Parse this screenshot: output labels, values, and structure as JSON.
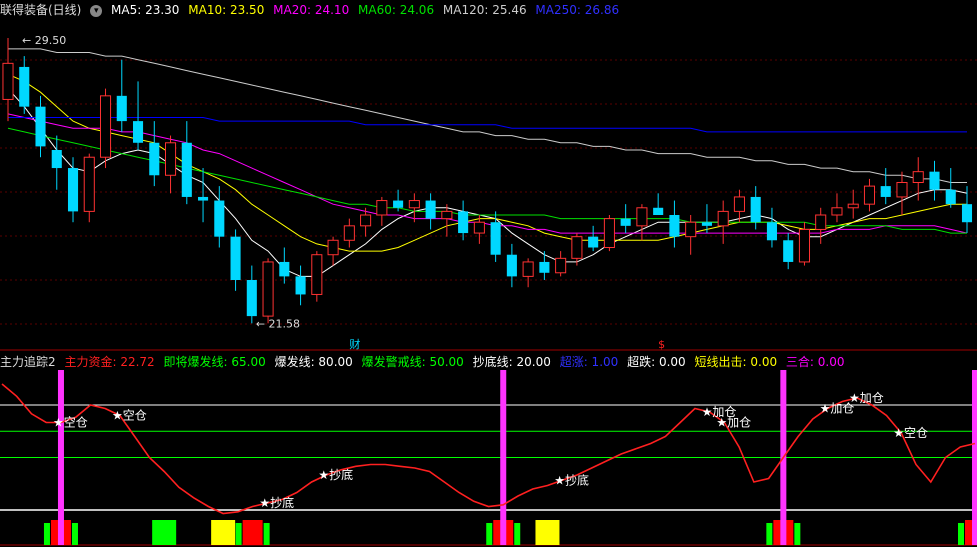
{
  "colors": {
    "up": "#ff3232",
    "down": "#00d8ff",
    "ma5": "#ffffff",
    "ma10": "#ffff00",
    "ma20": "#ff00ff",
    "ma60": "#00e000",
    "ma120": "#cccccc",
    "ma250": "#0000ff",
    "main_fund": "#ff2020",
    "about_to_burst": "#00ff00",
    "burst": "#ffffff",
    "warn": "#00ff00",
    "bottom": "#ffffff",
    "surge": "#0000ff",
    "over": "#ffffff",
    "short_exit": "#ffff00",
    "three": "#ff00ff",
    "bg": "#000000"
  },
  "top_header": {
    "title": "联得装备(日线)",
    "ma5": "MA5: 23.30",
    "ma10": "MA10: 23.50",
    "ma20": "MA20: 24.10",
    "ma60": "MA60: 24.06",
    "ma120": "MA120: 25.46",
    "ma250": "MA250: 26.86"
  },
  "bottom_header": {
    "title": "主力追踪2",
    "main_fund": "主力资金: 22.72",
    "about_to_burst": "即将爆发线: 65.00",
    "burst": "爆发线: 80.00",
    "warn": "爆发警戒线: 50.00",
    "bottom": "抄底线: 20.00",
    "surge": "超涨: 1.00",
    "over": "超跌: 0.00",
    "short_exit": "短线出击: 0.00",
    "three": "三合: 0.00"
  },
  "price_labels": {
    "high": "29.50",
    "low": "21.58"
  },
  "markers": {
    "finance": "财",
    "dividend": "$"
  },
  "chart_data": [
    {
      "type": "candlestick",
      "title": "联得装备(日线)",
      "ylim": [
        21,
        30
      ],
      "ohlc": [
        [
          27.8,
          29.5,
          27.2,
          28.8
        ],
        [
          28.7,
          29.0,
          27.4,
          27.6
        ],
        [
          27.6,
          27.9,
          26.2,
          26.5
        ],
        [
          26.4,
          26.8,
          25.3,
          25.9
        ],
        [
          25.9,
          26.2,
          24.4,
          24.7
        ],
        [
          24.7,
          26.3,
          24.4,
          26.2
        ],
        [
          26.2,
          28.1,
          25.9,
          27.9
        ],
        [
          27.9,
          28.9,
          26.9,
          27.2
        ],
        [
          27.2,
          28.3,
          26.4,
          26.6
        ],
        [
          26.6,
          27.2,
          25.4,
          25.7
        ],
        [
          25.7,
          26.8,
          25.2,
          26.6
        ],
        [
          26.6,
          27.2,
          24.9,
          25.1
        ],
        [
          25.1,
          25.9,
          24.4,
          25.0
        ],
        [
          25.0,
          25.4,
          23.7,
          24.0
        ],
        [
          24.0,
          24.2,
          22.5,
          22.8
        ],
        [
          22.8,
          23.2,
          21.6,
          21.8
        ],
        [
          21.8,
          23.4,
          21.6,
          23.3
        ],
        [
          23.3,
          23.7,
          22.7,
          22.9
        ],
        [
          22.9,
          23.2,
          22.1,
          22.4
        ],
        [
          22.4,
          23.6,
          22.2,
          23.5
        ],
        [
          23.5,
          24.0,
          23.2,
          23.9
        ],
        [
          23.9,
          24.5,
          23.7,
          24.3
        ],
        [
          24.3,
          24.8,
          24.0,
          24.6
        ],
        [
          24.6,
          25.1,
          24.3,
          25.0
        ],
        [
          25.0,
          25.3,
          24.7,
          24.8
        ],
        [
          24.8,
          25.2,
          24.4,
          25.0
        ],
        [
          25.0,
          25.2,
          24.2,
          24.5
        ],
        [
          24.5,
          24.9,
          24.0,
          24.7
        ],
        [
          24.7,
          25.0,
          23.9,
          24.1
        ],
        [
          24.1,
          24.6,
          23.8,
          24.4
        ],
        [
          24.4,
          24.7,
          23.3,
          23.5
        ],
        [
          23.5,
          23.8,
          22.6,
          22.9
        ],
        [
          22.9,
          23.4,
          22.6,
          23.3
        ],
        [
          23.3,
          23.6,
          22.8,
          23.0
        ],
        [
          23.0,
          23.6,
          22.9,
          23.4
        ],
        [
          23.4,
          24.1,
          23.2,
          24.0
        ],
        [
          24.0,
          24.3,
          23.6,
          23.7
        ],
        [
          23.7,
          24.6,
          23.6,
          24.5
        ],
        [
          24.5,
          24.9,
          24.1,
          24.3
        ],
        [
          24.3,
          24.9,
          23.9,
          24.8
        ],
        [
          24.8,
          25.2,
          24.6,
          24.6
        ],
        [
          24.6,
          25.0,
          23.7,
          24.0
        ],
        [
          24.0,
          24.6,
          23.5,
          24.4
        ],
        [
          24.4,
          24.9,
          24.1,
          24.3
        ],
        [
          24.3,
          25.0,
          23.8,
          24.7
        ],
        [
          24.7,
          25.3,
          24.4,
          25.1
        ],
        [
          25.1,
          25.4,
          24.2,
          24.4
        ],
        [
          24.4,
          24.8,
          23.7,
          23.9
        ],
        [
          23.9,
          24.1,
          23.1,
          23.3
        ],
        [
          23.3,
          24.4,
          23.2,
          24.2
        ],
        [
          24.2,
          24.8,
          23.8,
          24.6
        ],
        [
          24.6,
          25.2,
          24.4,
          24.8
        ],
        [
          24.8,
          25.3,
          24.5,
          24.9
        ],
        [
          24.9,
          25.6,
          24.7,
          25.4
        ],
        [
          25.4,
          25.9,
          24.9,
          25.1
        ],
        [
          25.1,
          25.8,
          24.6,
          25.5
        ],
        [
          25.5,
          26.2,
          25.0,
          25.8
        ],
        [
          25.8,
          26.1,
          25.0,
          25.3
        ],
        [
          25.3,
          25.9,
          24.8,
          24.9
        ],
        [
          24.9,
          25.4,
          24.1,
          24.4
        ]
      ],
      "ma": [
        {
          "name": "MA5",
          "values": [
            28.1,
            27.6,
            27.0,
            26.4,
            25.9,
            25.8,
            26.1,
            26.3,
            26.4,
            26.3,
            26.0,
            25.7,
            25.5,
            25.0,
            24.5,
            23.9,
            23.6,
            23.1,
            22.9,
            22.9,
            23.2,
            23.5,
            23.8,
            24.2,
            24.5,
            24.7,
            24.8,
            24.8,
            24.7,
            24.6,
            24.5,
            24.1,
            23.8,
            23.5,
            23.3,
            23.3,
            23.5,
            23.8,
            24.0,
            24.2,
            24.4,
            24.4,
            24.4,
            24.4,
            24.4,
            24.5,
            24.6,
            24.5,
            24.2,
            24.0,
            24.0,
            24.2,
            24.4,
            24.6,
            24.8,
            25.0,
            25.2,
            25.3,
            25.3,
            25.2
          ]
        },
        {
          "name": "MA10",
          "values": [
            28.5,
            28.3,
            28.0,
            27.6,
            27.2,
            27.0,
            26.9,
            26.8,
            26.7,
            26.6,
            26.3,
            26.0,
            25.8,
            25.6,
            25.3,
            24.9,
            24.6,
            24.3,
            24.0,
            23.8,
            23.7,
            23.6,
            23.6,
            23.6,
            23.7,
            23.9,
            24.1,
            24.3,
            24.4,
            24.5,
            24.5,
            24.4,
            24.3,
            24.1,
            24.0,
            23.9,
            23.9,
            23.9,
            23.9,
            23.9,
            23.9,
            24.0,
            24.1,
            24.2,
            24.3,
            24.4,
            24.4,
            24.4,
            24.3,
            24.2,
            24.2,
            24.3,
            24.4,
            24.5,
            24.5,
            24.6,
            24.7,
            24.8,
            24.9,
            24.9
          ]
        },
        {
          "name": "MA20",
          "values": [
            27.4,
            27.3,
            27.2,
            27.1,
            27.0,
            27.0,
            27.0,
            26.9,
            26.9,
            26.8,
            26.7,
            26.6,
            26.4,
            26.3,
            26.1,
            25.9,
            25.7,
            25.5,
            25.3,
            25.1,
            24.9,
            24.8,
            24.7,
            24.6,
            24.6,
            24.5,
            24.5,
            24.5,
            24.4,
            24.4,
            24.3,
            24.3,
            24.2,
            24.2,
            24.1,
            24.1,
            24.1,
            24.1,
            24.1,
            24.1,
            24.1,
            24.1,
            24.1,
            24.1,
            24.1,
            24.1,
            24.1,
            24.1,
            24.1,
            24.1,
            24.1,
            24.2,
            24.2,
            24.2,
            24.3,
            24.3,
            24.3,
            24.3,
            24.2,
            24.1
          ]
        },
        {
          "name": "MA60",
          "values": [
            27.0,
            26.9,
            26.8,
            26.7,
            26.6,
            26.5,
            26.4,
            26.3,
            26.2,
            26.1,
            26.0,
            25.9,
            25.8,
            25.7,
            25.6,
            25.5,
            25.4,
            25.3,
            25.2,
            25.1,
            25.0,
            24.9,
            24.9,
            24.8,
            24.8,
            24.7,
            24.7,
            24.7,
            24.6,
            24.6,
            24.6,
            24.6,
            24.6,
            24.6,
            24.5,
            24.5,
            24.5,
            24.5,
            24.5,
            24.5,
            24.5,
            24.5,
            24.4,
            24.4,
            24.4,
            24.4,
            24.4,
            24.4,
            24.4,
            24.4,
            24.3,
            24.3,
            24.3,
            24.3,
            24.3,
            24.2,
            24.2,
            24.2,
            24.1,
            24.1
          ]
        },
        {
          "name": "MA120",
          "values": [
            29.2,
            29.2,
            29.2,
            29.1,
            29.1,
            29.1,
            29.0,
            29.0,
            28.9,
            28.8,
            28.7,
            28.6,
            28.5,
            28.4,
            28.3,
            28.2,
            28.1,
            28.0,
            27.9,
            27.8,
            27.7,
            27.6,
            27.5,
            27.4,
            27.3,
            27.2,
            27.1,
            27.0,
            26.9,
            26.9,
            26.8,
            26.8,
            26.7,
            26.7,
            26.6,
            26.6,
            26.5,
            26.5,
            26.4,
            26.4,
            26.3,
            26.3,
            26.3,
            26.2,
            26.2,
            26.2,
            26.1,
            26.1,
            26.0,
            26.0,
            25.9,
            25.9,
            25.8,
            25.8,
            25.7,
            25.7,
            25.6,
            25.6,
            25.5,
            25.5
          ]
        },
        {
          "name": "MA250",
          "values": [
            27.3,
            27.3,
            27.3,
            27.3,
            27.3,
            27.3,
            27.3,
            27.3,
            27.3,
            27.3,
            27.3,
            27.3,
            27.3,
            27.2,
            27.2,
            27.2,
            27.2,
            27.2,
            27.2,
            27.2,
            27.2,
            27.2,
            27.1,
            27.1,
            27.1,
            27.1,
            27.1,
            27.1,
            27.1,
            27.1,
            27.1,
            27.0,
            27.0,
            27.0,
            27.0,
            27.0,
            27.0,
            27.0,
            27.0,
            27.0,
            27.0,
            27.0,
            27.0,
            26.9,
            26.9,
            26.9,
            26.9,
            26.9,
            26.9,
            26.9,
            26.9,
            26.9,
            26.9,
            26.9,
            26.9,
            26.9,
            26.9,
            26.9,
            26.9,
            26.9
          ]
        }
      ]
    },
    {
      "type": "line",
      "title": "主力追踪2",
      "ylim": [
        0,
        100
      ],
      "levels": [
        {
          "name": "爆发线",
          "value": 80
        },
        {
          "name": "即将爆发线",
          "value": 65
        },
        {
          "name": "爆发警戒线",
          "value": 50
        },
        {
          "name": "抄底线",
          "value": 20
        }
      ],
      "series": [
        {
          "name": "主力资金",
          "values": [
            92,
            85,
            75,
            70,
            70,
            73,
            80,
            78,
            74,
            62,
            50,
            42,
            33,
            27,
            22,
            18,
            19,
            22,
            24,
            26,
            30,
            36,
            40,
            43,
            45,
            46,
            46,
            45,
            44,
            42,
            36,
            30,
            25,
            22,
            23,
            28,
            32,
            34,
            37,
            40,
            44,
            48,
            52,
            55,
            58,
            62,
            70,
            78,
            76,
            70,
            56,
            36,
            38,
            50,
            62,
            72,
            78,
            82,
            84,
            80,
            74,
            64,
            46,
            36,
            50,
            56,
            58
          ]
        }
      ],
      "labels": [
        {
          "text": "★空仓",
          "i": 4
        },
        {
          "text": "★空仓",
          "i": 8
        },
        {
          "text": "★抄底",
          "i": 18
        },
        {
          "text": "★抄底",
          "i": 22
        },
        {
          "text": "★抄底",
          "i": 38
        },
        {
          "text": "★加仓",
          "i": 48
        },
        {
          "text": "★加仓",
          "i": 49
        },
        {
          "text": "★加仓",
          "i": 56
        },
        {
          "text": "★加仓",
          "i": 58
        },
        {
          "text": "★空仓",
          "i": 61
        }
      ],
      "pink_bars": [
        4,
        34,
        53,
        66
      ],
      "blocks": [
        {
          "i": 4,
          "color": "red"
        },
        {
          "i": 11,
          "color": "green"
        },
        {
          "i": 15,
          "color": "yellow"
        },
        {
          "i": 17,
          "color": "red"
        },
        {
          "i": 34,
          "color": "red"
        },
        {
          "i": 37,
          "color": "yellow"
        },
        {
          "i": 53,
          "color": "red"
        },
        {
          "i": 66,
          "color": "red"
        }
      ]
    }
  ]
}
